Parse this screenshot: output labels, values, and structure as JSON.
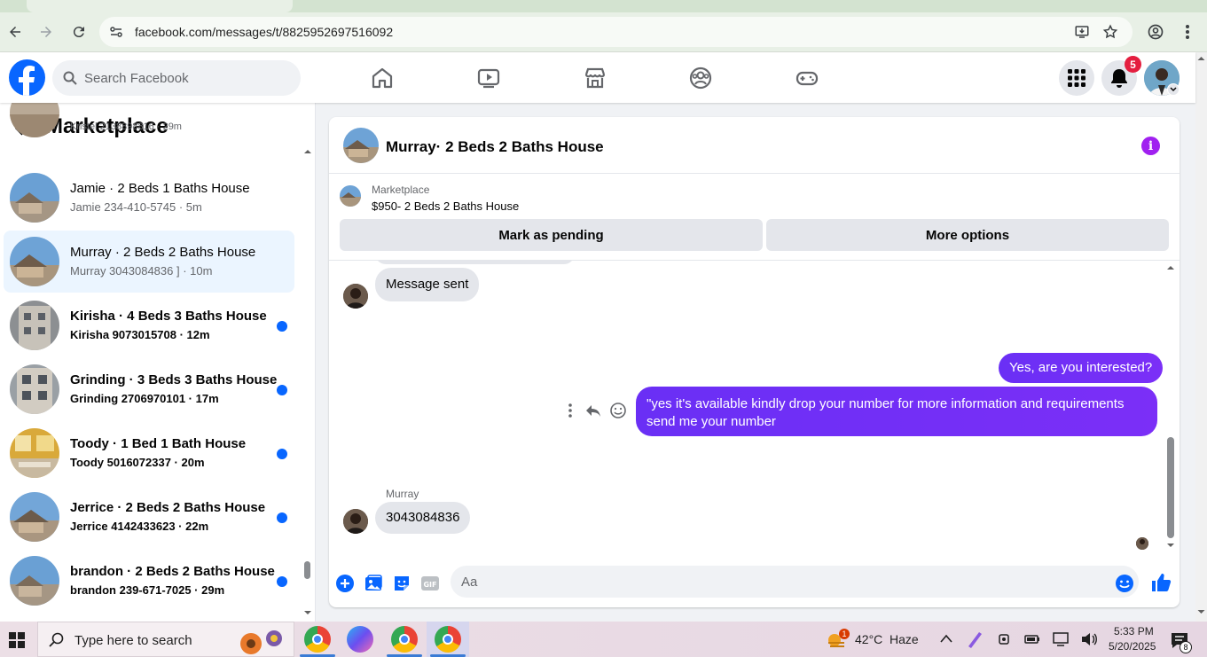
{
  "browser": {
    "url": "facebook.com/messages/t/8825952697516092"
  },
  "header": {
    "search_placeholder": "Search Facebook",
    "notification_count": "5"
  },
  "sidebar": {
    "title": "Marketplace",
    "partial_top_text": "Kristel 2138898816 · 29m",
    "conversations": [
      {
        "name": "Jamie · 2 Beds 1 Baths House",
        "sub": "Jamie 234-410-5745 · 5m",
        "unread": false,
        "active": false
      },
      {
        "name": "Murray · 2 Beds 2 Baths House",
        "sub": "Murray 3043084836 ] · 10m",
        "unread": false,
        "active": true
      },
      {
        "name": "Kirisha · 4 Beds 3 Baths House",
        "sub": "Kirisha 9073015708 · 12m",
        "unread": true,
        "active": false
      },
      {
        "name": "Grinding · 3 Beds 3 Baths House",
        "sub": "Grinding 2706970101 · 17m",
        "unread": true,
        "active": false
      },
      {
        "name": "Toody · 1 Bed 1 Bath House",
        "sub": "Toody 5016072337 · 20m",
        "unread": true,
        "active": false
      },
      {
        "name": "Jerrice · 2 Beds 2 Baths House",
        "sub": "Jerrice 4142433623 · 22m",
        "unread": true,
        "active": false
      },
      {
        "name": "brandon · 2 Beds 2 Baths House",
        "sub": "brandon 239-671-7025 · 29m",
        "unread": true,
        "active": false
      }
    ]
  },
  "chat": {
    "title": "Murray· 2 Beds 2 Baths House",
    "listing_source": "Marketplace",
    "listing_price": "$950- 2 Beds 2 Baths House",
    "mark_pending_label": "Mark as pending",
    "more_options_label": "More options",
    "messages": {
      "in_1": "Message sent",
      "out_1": "Yes, are you interested?",
      "out_2": "\"yes it's available kindly drop your number for more information and requirements send me your number",
      "sender_name": "Murray",
      "in_2": "3043084836"
    },
    "composer_placeholder": "Aa"
  },
  "taskbar": {
    "search_placeholder": "Type here to search",
    "weather_temp": "42°C",
    "weather_desc": "Haze",
    "weather_badge": "1",
    "time": "5:33 PM",
    "date": "5/20/2025",
    "notif_count": "8"
  }
}
